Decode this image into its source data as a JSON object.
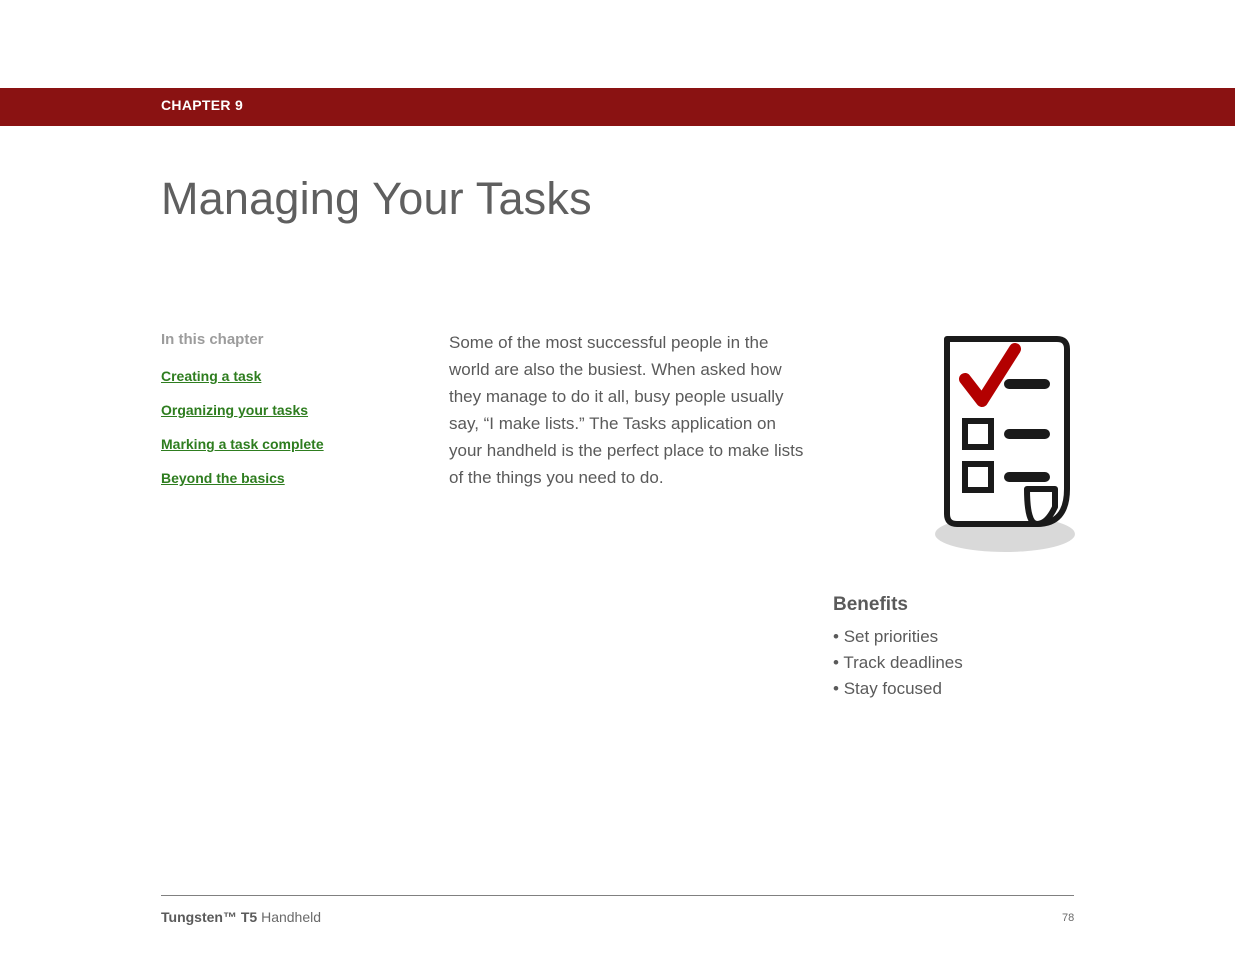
{
  "header": {
    "chapter_label": "CHAPTER 9"
  },
  "title": "Managing Your Tasks",
  "sidebar": {
    "heading": "In this chapter",
    "links": [
      "Creating a task",
      "Organizing your tasks",
      "Marking a task complete",
      "Beyond the basics"
    ]
  },
  "intro_text": "Some of the most successful people in the world are also the busiest. When asked how they manage to do it all, busy people usually say, “I make lists.” The Tasks application on your handheld is the perfect place to make lists of the things you need to do.",
  "benefits": {
    "heading": "Benefits",
    "items": [
      "Set priorities",
      "Track deadlines",
      "Stay focused"
    ]
  },
  "footer": {
    "product_bold": "Tungsten™ T5",
    "product_rest": " Handheld",
    "page_number": "78"
  }
}
